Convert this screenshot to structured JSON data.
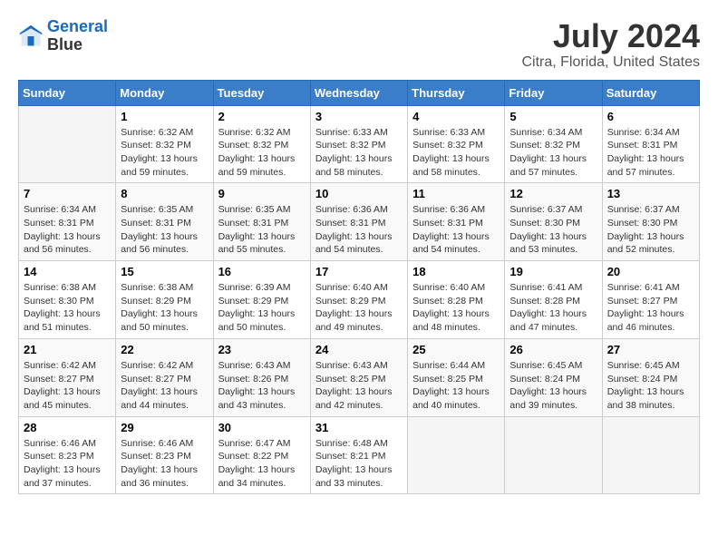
{
  "header": {
    "logo_line1": "General",
    "logo_line2": "Blue",
    "title": "July 2024",
    "subtitle": "Citra, Florida, United States"
  },
  "calendar": {
    "days_of_week": [
      "Sunday",
      "Monday",
      "Tuesday",
      "Wednesday",
      "Thursday",
      "Friday",
      "Saturday"
    ],
    "weeks": [
      [
        {
          "num": "",
          "info": ""
        },
        {
          "num": "1",
          "info": "Sunrise: 6:32 AM\nSunset: 8:32 PM\nDaylight: 13 hours\nand 59 minutes."
        },
        {
          "num": "2",
          "info": "Sunrise: 6:32 AM\nSunset: 8:32 PM\nDaylight: 13 hours\nand 59 minutes."
        },
        {
          "num": "3",
          "info": "Sunrise: 6:33 AM\nSunset: 8:32 PM\nDaylight: 13 hours\nand 58 minutes."
        },
        {
          "num": "4",
          "info": "Sunrise: 6:33 AM\nSunset: 8:32 PM\nDaylight: 13 hours\nand 58 minutes."
        },
        {
          "num": "5",
          "info": "Sunrise: 6:34 AM\nSunset: 8:32 PM\nDaylight: 13 hours\nand 57 minutes."
        },
        {
          "num": "6",
          "info": "Sunrise: 6:34 AM\nSunset: 8:31 PM\nDaylight: 13 hours\nand 57 minutes."
        }
      ],
      [
        {
          "num": "7",
          "info": "Sunrise: 6:34 AM\nSunset: 8:31 PM\nDaylight: 13 hours\nand 56 minutes."
        },
        {
          "num": "8",
          "info": "Sunrise: 6:35 AM\nSunset: 8:31 PM\nDaylight: 13 hours\nand 56 minutes."
        },
        {
          "num": "9",
          "info": "Sunrise: 6:35 AM\nSunset: 8:31 PM\nDaylight: 13 hours\nand 55 minutes."
        },
        {
          "num": "10",
          "info": "Sunrise: 6:36 AM\nSunset: 8:31 PM\nDaylight: 13 hours\nand 54 minutes."
        },
        {
          "num": "11",
          "info": "Sunrise: 6:36 AM\nSunset: 8:31 PM\nDaylight: 13 hours\nand 54 minutes."
        },
        {
          "num": "12",
          "info": "Sunrise: 6:37 AM\nSunset: 8:30 PM\nDaylight: 13 hours\nand 53 minutes."
        },
        {
          "num": "13",
          "info": "Sunrise: 6:37 AM\nSunset: 8:30 PM\nDaylight: 13 hours\nand 52 minutes."
        }
      ],
      [
        {
          "num": "14",
          "info": "Sunrise: 6:38 AM\nSunset: 8:30 PM\nDaylight: 13 hours\nand 51 minutes."
        },
        {
          "num": "15",
          "info": "Sunrise: 6:38 AM\nSunset: 8:29 PM\nDaylight: 13 hours\nand 50 minutes."
        },
        {
          "num": "16",
          "info": "Sunrise: 6:39 AM\nSunset: 8:29 PM\nDaylight: 13 hours\nand 50 minutes."
        },
        {
          "num": "17",
          "info": "Sunrise: 6:40 AM\nSunset: 8:29 PM\nDaylight: 13 hours\nand 49 minutes."
        },
        {
          "num": "18",
          "info": "Sunrise: 6:40 AM\nSunset: 8:28 PM\nDaylight: 13 hours\nand 48 minutes."
        },
        {
          "num": "19",
          "info": "Sunrise: 6:41 AM\nSunset: 8:28 PM\nDaylight: 13 hours\nand 47 minutes."
        },
        {
          "num": "20",
          "info": "Sunrise: 6:41 AM\nSunset: 8:27 PM\nDaylight: 13 hours\nand 46 minutes."
        }
      ],
      [
        {
          "num": "21",
          "info": "Sunrise: 6:42 AM\nSunset: 8:27 PM\nDaylight: 13 hours\nand 45 minutes."
        },
        {
          "num": "22",
          "info": "Sunrise: 6:42 AM\nSunset: 8:27 PM\nDaylight: 13 hours\nand 44 minutes."
        },
        {
          "num": "23",
          "info": "Sunrise: 6:43 AM\nSunset: 8:26 PM\nDaylight: 13 hours\nand 43 minutes."
        },
        {
          "num": "24",
          "info": "Sunrise: 6:43 AM\nSunset: 8:25 PM\nDaylight: 13 hours\nand 42 minutes."
        },
        {
          "num": "25",
          "info": "Sunrise: 6:44 AM\nSunset: 8:25 PM\nDaylight: 13 hours\nand 40 minutes."
        },
        {
          "num": "26",
          "info": "Sunrise: 6:45 AM\nSunset: 8:24 PM\nDaylight: 13 hours\nand 39 minutes."
        },
        {
          "num": "27",
          "info": "Sunrise: 6:45 AM\nSunset: 8:24 PM\nDaylight: 13 hours\nand 38 minutes."
        }
      ],
      [
        {
          "num": "28",
          "info": "Sunrise: 6:46 AM\nSunset: 8:23 PM\nDaylight: 13 hours\nand 37 minutes."
        },
        {
          "num": "29",
          "info": "Sunrise: 6:46 AM\nSunset: 8:23 PM\nDaylight: 13 hours\nand 36 minutes."
        },
        {
          "num": "30",
          "info": "Sunrise: 6:47 AM\nSunset: 8:22 PM\nDaylight: 13 hours\nand 34 minutes."
        },
        {
          "num": "31",
          "info": "Sunrise: 6:48 AM\nSunset: 8:21 PM\nDaylight: 13 hours\nand 33 minutes."
        },
        {
          "num": "",
          "info": ""
        },
        {
          "num": "",
          "info": ""
        },
        {
          "num": "",
          "info": ""
        }
      ]
    ]
  }
}
